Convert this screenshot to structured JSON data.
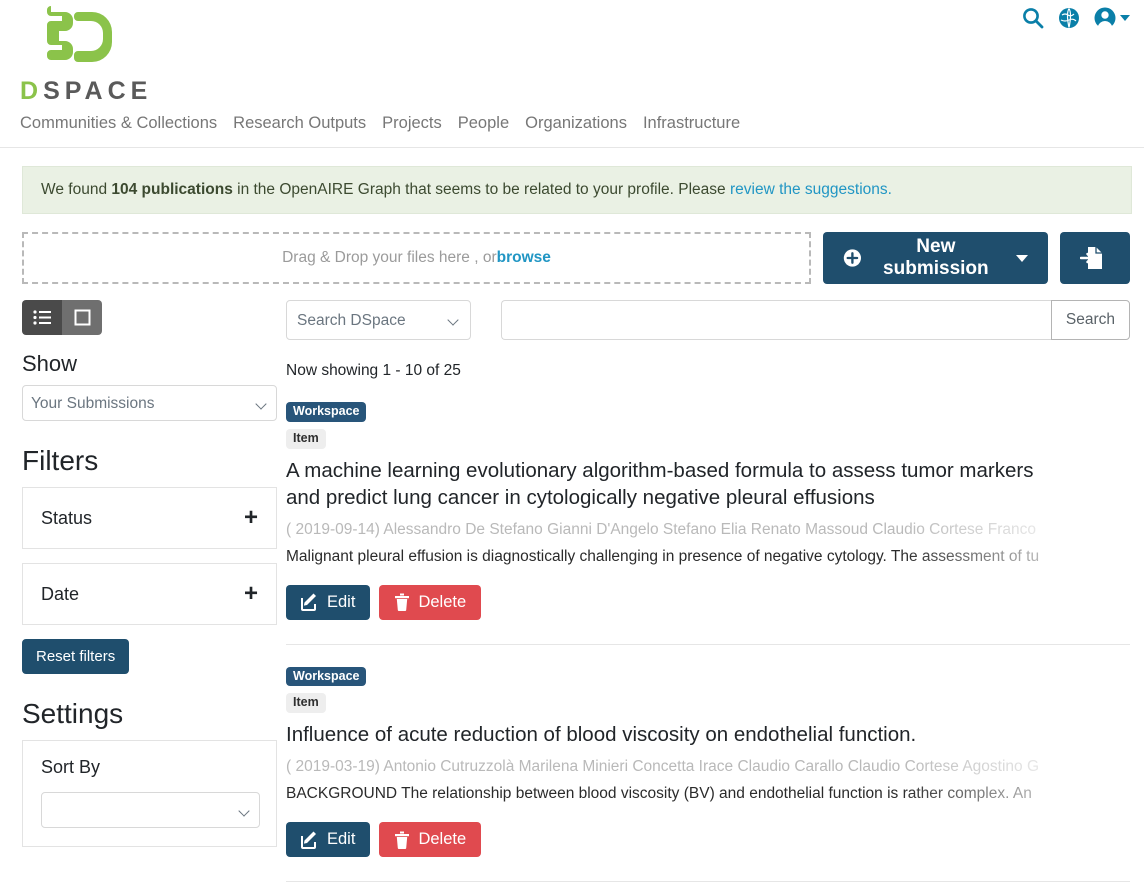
{
  "header": {
    "brand": {
      "word_first": "D",
      "word_rest": "SPACE",
      "logo_icon": "dspace-logo-icon"
    },
    "icons": [
      {
        "name": "search-icon",
        "label": "Search"
      },
      {
        "name": "globe-icon",
        "label": "Language"
      },
      {
        "name": "user-account-icon",
        "label": "Account"
      }
    ],
    "nav": [
      {
        "label": "Communities & Collections"
      },
      {
        "label": "Research Outputs"
      },
      {
        "label": "Projects"
      },
      {
        "label": "People"
      },
      {
        "label": "Organizations"
      },
      {
        "label": "Infrastructure"
      }
    ]
  },
  "alert": {
    "lead": "We found ",
    "count": "104 publications",
    "middle": " in the OpenAIRE Graph that seems to be related to your profile. Please ",
    "link": "review the suggestions.",
    "bg_color": "#eaf1e4"
  },
  "upload": {
    "dropzone_text": "Drag & Drop your files here , or ",
    "dropzone_link": "browse",
    "new_submission_label": "New submission",
    "new_submission_icon": "plus-circle-icon",
    "import_icon": "file-import-icon"
  },
  "sidebar": {
    "view_toggle": {
      "list_icon": "list-view-icon",
      "grid_icon": "grid-view-icon",
      "active": "list"
    },
    "show_label": "Show",
    "show_value": "Your Submissions",
    "show_options": [
      "Your Submissions"
    ],
    "filters_heading": "Filters",
    "filters": [
      {
        "name": "Status",
        "expand": "+"
      },
      {
        "name": "Date",
        "expand": "+"
      }
    ],
    "reset_label": "Reset filters",
    "settings_heading": "Settings",
    "sort_by_label": "Sort By"
  },
  "search": {
    "scope_value": "Search DSpace",
    "scope_options": [
      "Search DSpace"
    ],
    "query_value": "",
    "query_placeholder": "",
    "button_label": "Search"
  },
  "results": {
    "showing": "Now showing 1 - 10 of 25",
    "items": [
      {
        "badge_workspace": "Workspace",
        "badge_item": "Item",
        "title": "A machine learning evolutionary algorithm-based formula to assess tumor markers and predict lung cancer in cytologically negative pleural effusions",
        "meta": "( 2019-09-14) Alessandro De Stefano Gianni D'Angelo Stefano Elia Renato Massoud Claudio Cortese Franco",
        "abstract": "Malignant pleural effusion is diagnostically challenging in presence of negative cytology. The assessment of tu",
        "edit_label": "Edit",
        "delete_label": "Delete",
        "edit_icon": "pencil-square-icon",
        "delete_icon": "trash-icon"
      },
      {
        "badge_workspace": "Workspace",
        "badge_item": "Item",
        "title": "Influence of acute reduction of blood viscosity on endothelial function.",
        "meta": "( 2019-03-19) Antonio Cutruzzolà Marilena Minieri Concetta Irace Claudio Carallo Claudio Cortese Agostino G",
        "abstract": "BACKGROUND The relationship between blood viscosity (BV) and endothelial function is rather complex. An",
        "edit_label": "Edit",
        "delete_label": "Delete",
        "edit_icon": "pencil-square-icon",
        "delete_icon": "trash-icon"
      }
    ]
  },
  "colors": {
    "brand_green": "#8bc34a",
    "primary_navy": "#1f4e6d",
    "danger_red": "#e04a4f",
    "link_blue": "#2196c4",
    "icon_teal": "#0a7fa8"
  }
}
